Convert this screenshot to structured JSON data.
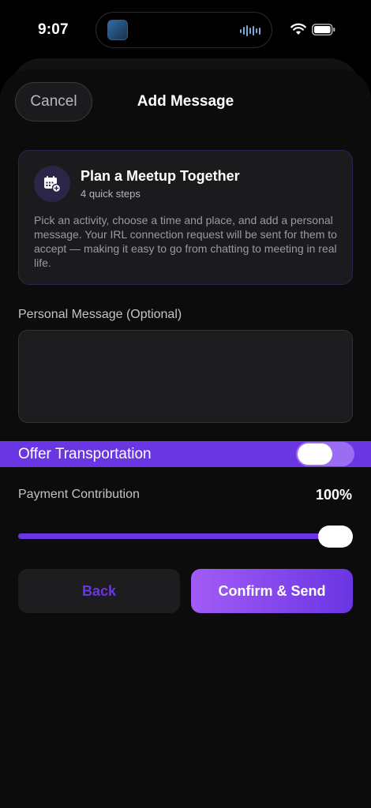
{
  "status_bar": {
    "time": "9:07",
    "icons": [
      "wifi-icon",
      "battery-icon"
    ]
  },
  "header": {
    "cancel_label": "Cancel",
    "title": "Add Message"
  },
  "info_card": {
    "icon": "calendar-plus-icon",
    "title": "Plan a Meetup Together",
    "subtitle": "4 quick steps",
    "description": "Pick an activity, choose a time and place, and add a personal message. Your IRL connection request will be sent for them to accept — making it easy to go from chatting to meeting in real life."
  },
  "personal_message": {
    "label": "Personal Message (Optional)",
    "value": "",
    "placeholder": ""
  },
  "transportation": {
    "label": "Offer Transportation",
    "enabled": false
  },
  "payment": {
    "label": "Payment Contribution",
    "value_text": "100%",
    "value": 1.0
  },
  "actions": {
    "back_label": "Back",
    "confirm_label": "Confirm & Send"
  },
  "colors": {
    "accent": "#6a35e2",
    "accent_light": "#a25cf6",
    "background": "#0c0c0d"
  }
}
